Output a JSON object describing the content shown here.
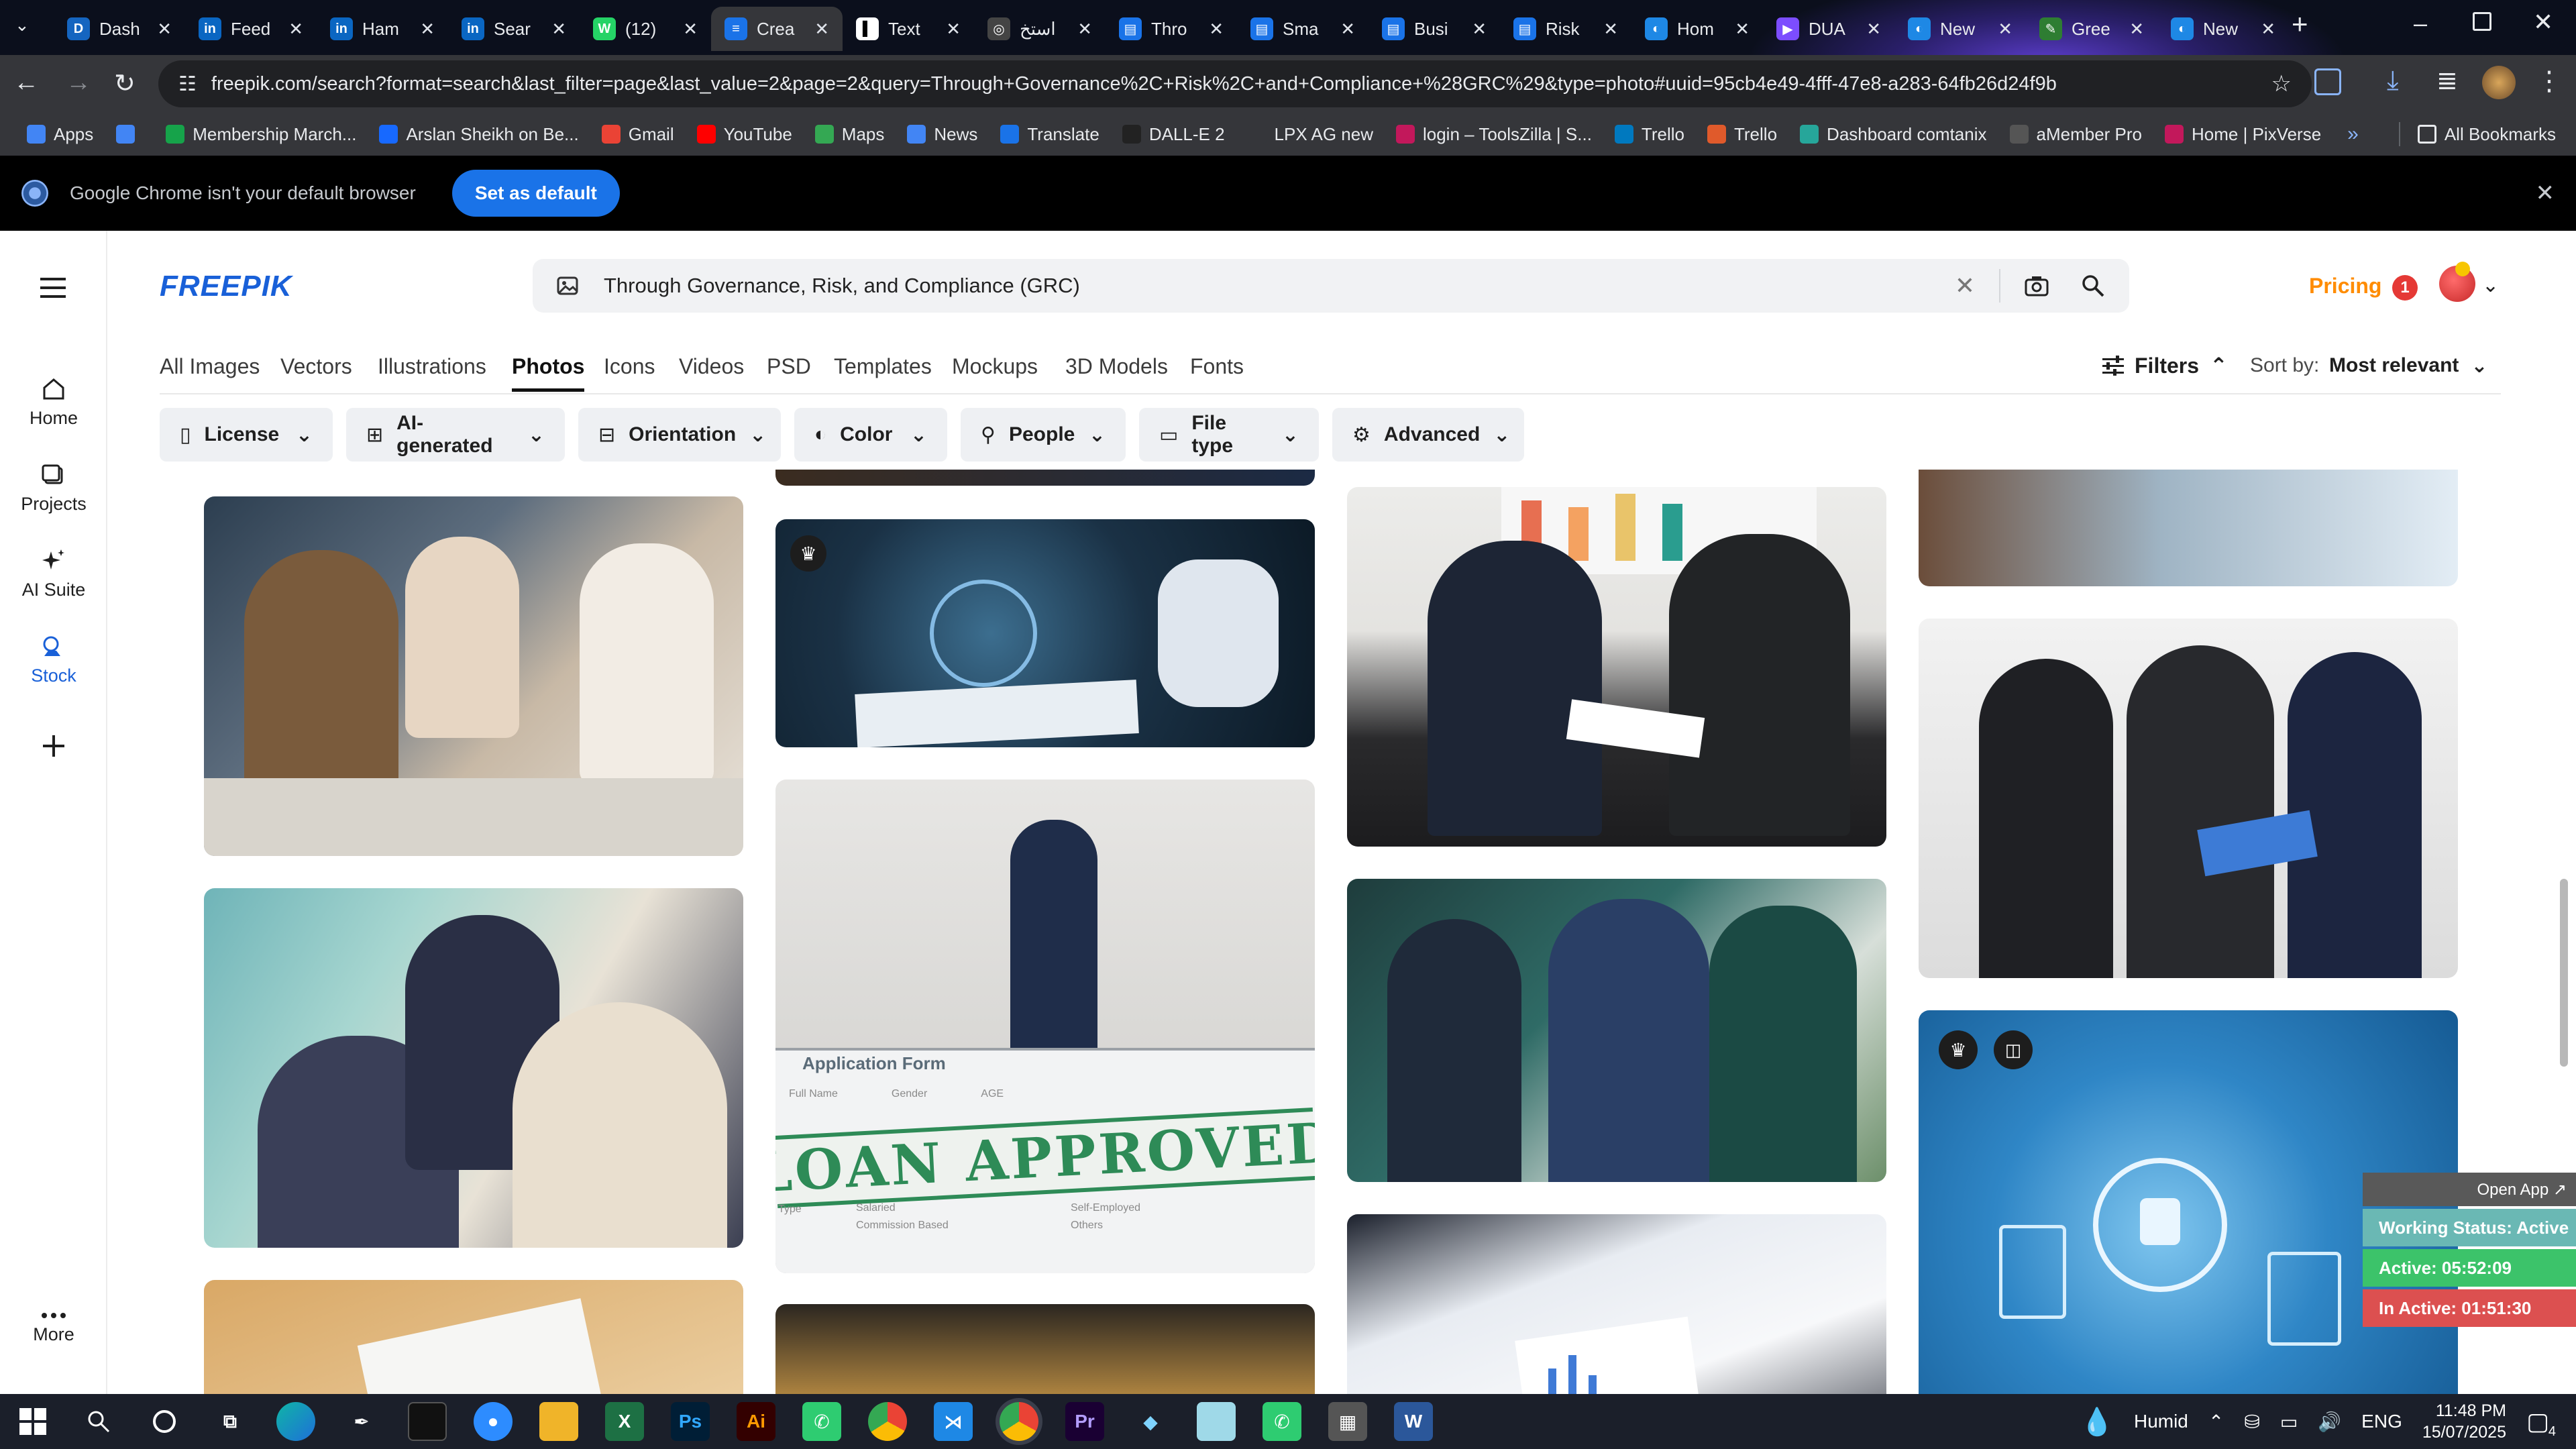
{
  "browser": {
    "tabs": [
      {
        "label": "Dash",
        "color": "#1565c0",
        "glyph": "D"
      },
      {
        "label": "Feed",
        "color": "#0a66c2",
        "glyph": "in"
      },
      {
        "label": "Ham",
        "color": "#0a66c2",
        "glyph": "in"
      },
      {
        "label": "Sear",
        "color": "#0a66c2",
        "glyph": "in"
      },
      {
        "label": "(12)",
        "color": "#25d366",
        "glyph": "W"
      },
      {
        "label": "Crea",
        "color": "#1a73e8",
        "glyph": "≡"
      },
      {
        "label": "Text",
        "color": "#ffffff",
        "glyph": "▌"
      },
      {
        "label": "استخ",
        "color": "#444444",
        "glyph": "◎"
      },
      {
        "label": "Thro",
        "color": "#1a73e8",
        "glyph": "▤"
      },
      {
        "label": "Sma",
        "color": "#1a73e8",
        "glyph": "▤"
      },
      {
        "label": "Busi",
        "color": "#1a73e8",
        "glyph": "▤"
      },
      {
        "label": "Risk",
        "color": "#1a73e8",
        "glyph": "▤"
      },
      {
        "label": "Hom",
        "color": "#1e88e5",
        "glyph": "◐"
      },
      {
        "label": "DUA",
        "color": "#7c4dff",
        "glyph": "▶"
      },
      {
        "label": "New",
        "color": "#1e88e5",
        "glyph": "◐"
      },
      {
        "label": "Gree",
        "color": "#2e7d32",
        "glyph": "✎"
      },
      {
        "label": "New",
        "color": "#1e88e5",
        "glyph": "◐"
      }
    ],
    "active_tab_index": 5,
    "url": "freepik.com/search?format=search&last_filter=page&last_value=2&page=2&query=Through+Governance%2C+Risk%2C+and+Compliance+%28GRC%29&type=photo#uuid=95cb4e49-4fff-47e8-a283-64fb26d24f9b",
    "bookmarks": [
      {
        "label": "Apps",
        "color": "#4285f4"
      },
      {
        "label": "",
        "color": "#4285f4"
      },
      {
        "label": "Membership March...",
        "color": "#16a34a"
      },
      {
        "label": "Arslan Sheikh on Be...",
        "color": "#1769ff"
      },
      {
        "label": "Gmail",
        "color": "#ea4335"
      },
      {
        "label": "YouTube",
        "color": "#ff0000"
      },
      {
        "label": "Maps",
        "color": "#34a853"
      },
      {
        "label": "News",
        "color": "#4285f4"
      },
      {
        "label": "Translate",
        "color": "#1a73e8"
      },
      {
        "label": "DALL-E 2",
        "color": "#222222"
      },
      {
        "label": "LPX AG new",
        "color": "#35363a"
      },
      {
        "label": "login – ToolsZilla | S...",
        "color": "#c2185b"
      },
      {
        "label": "Trello",
        "color": "#0079bf"
      },
      {
        "label": "Trello",
        "color": "#e05a2b"
      },
      {
        "label": "Dashboard comtanix",
        "color": "#26a69a"
      },
      {
        "label": "aMember Pro",
        "color": "#555555"
      },
      {
        "label": "Home | PixVerse",
        "color": "#c2185b"
      }
    ],
    "all_bookmarks_label": "All Bookmarks",
    "infobar": {
      "message": "Google Chrome isn't your default browser",
      "button": "Set as default"
    }
  },
  "freepik": {
    "logo": "FREEPIK",
    "search": {
      "query": "Through Governance, Risk, and Compliance (GRC)"
    },
    "pricing_label": "Pricing",
    "notification_count": "1",
    "nav": [
      {
        "label": "Home",
        "icon": "home-icon"
      },
      {
        "label": "Projects",
        "icon": "projects-icon"
      },
      {
        "label": "AI Suite",
        "icon": "ai-suite-icon"
      },
      {
        "label": "Stock",
        "icon": "stock-icon"
      }
    ],
    "more_label": "More",
    "categories": [
      "All Images",
      "Vectors",
      "Illustrations",
      "Photos",
      "Icons",
      "Videos",
      "PSD",
      "Templates",
      "Mockups",
      "3D Models",
      "Fonts"
    ],
    "active_category": "Photos",
    "filters_label": "Filters",
    "sort_label": "Sort by:",
    "sort_value": "Most relevant",
    "filter_buttons": [
      "License",
      "AI-generated",
      "Orientation",
      "Color",
      "People",
      "File type",
      "Advanced"
    ],
    "photos": {
      "loan_title": "Application Form",
      "loan_big": "LOAN APPROVED",
      "loan_fields": [
        "Full Name",
        "Gender",
        "AGE",
        "Salaried",
        "Self-Employed",
        "Commission Based",
        "Others"
      ],
      "loan_footer": "Type"
    }
  },
  "status_widget": {
    "open_app": "Open App ↗",
    "working": "Working Status: Active",
    "active": "Active: 05:52:09",
    "inactive": "In Active: 01:51:30"
  },
  "taskbar": {
    "weather": "Humid",
    "language": "ENG",
    "time": "11:48 PM",
    "date": "15/07/2025",
    "notifications": "4"
  }
}
